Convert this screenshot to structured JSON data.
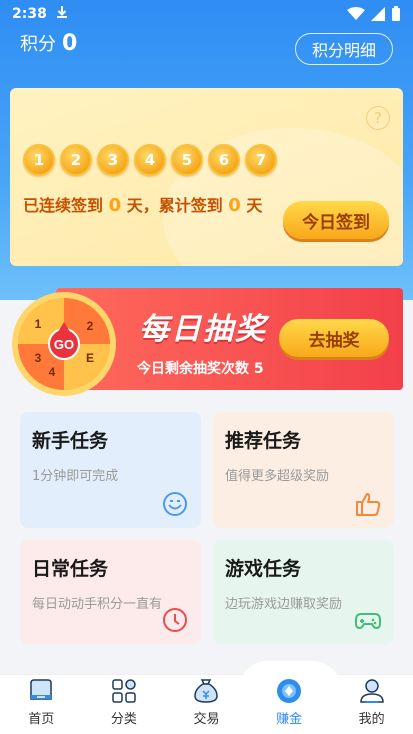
{
  "status": {
    "time": "2:38"
  },
  "points": {
    "label": "积分",
    "value": "0"
  },
  "detail_button": "积分明细",
  "checkin": {
    "help": "?",
    "coins": [
      "1",
      "2",
      "3",
      "4",
      "5",
      "6",
      "7"
    ],
    "streak_prefix": "已连续签到",
    "streak_days": "0",
    "streak_mid": "天，累计签到",
    "total_days": "0",
    "streak_suffix": "天",
    "button": "今日签到"
  },
  "lottery": {
    "title": "每日抽奖",
    "subtitle": "今日剩余抽奖次数 5",
    "button": "去抽奖",
    "wheel": {
      "center": "GO",
      "labels": [
        "1",
        "2",
        "3",
        "4"
      ],
      "partial_label": "E"
    }
  },
  "tasks": [
    {
      "title": "新手任务",
      "desc": "1分钟即可完成"
    },
    {
      "title": "推荐任务",
      "desc": "值得更多超级奖励"
    },
    {
      "title": "日常任务",
      "desc": "每日动动手积分一直有"
    },
    {
      "title": "游戏任务",
      "desc": "边玩游戏边赚取奖励"
    }
  ],
  "nav": [
    {
      "label": "首页"
    },
    {
      "label": "分类"
    },
    {
      "label": "交易"
    },
    {
      "label": "赚金"
    },
    {
      "label": "我的"
    }
  ],
  "colors": {
    "primary": "#2d8cf0",
    "accent": "#f8a81a",
    "lottery": "#f2404a"
  }
}
